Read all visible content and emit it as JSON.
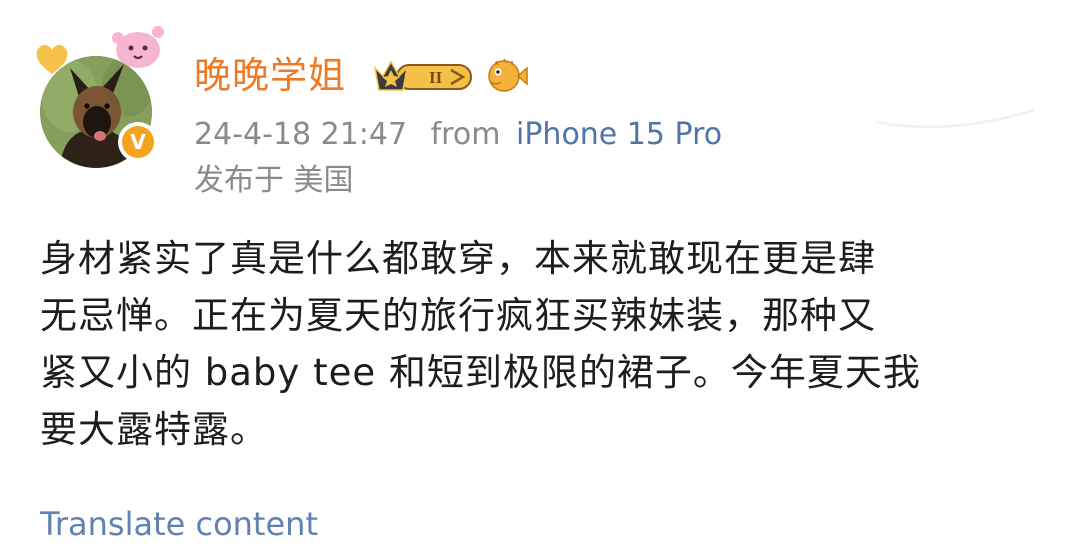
{
  "post": {
    "author": {
      "name": "晚晚学姐",
      "verified_mark": "V",
      "vip_level": "II",
      "avatar": "dog-avatar",
      "badges": [
        "crown-level-badge-icon",
        "pufferfish-badge-icon"
      ]
    },
    "meta": {
      "timestamp": "24-4-18 21:47",
      "from_label": "from",
      "device": "iPhone 15 Pro",
      "location": "发布于 美国"
    },
    "content_lines": [
      "身材紧实了真是什么都敢穿，本来就敢现在更是肆",
      "无忌惮。正在为夏天的旅行疯狂买辣妹装，那种又",
      "紧又小的 baby tee 和短到极限的裙子。今年夏天我",
      "要大露特露。"
    ],
    "translate_label": "Translate content"
  },
  "colors": {
    "username": "#ef7a24",
    "meta_text": "#8a8a8a",
    "source_link": "#5175a6",
    "translate_link": "#5f82b0",
    "body_text": "#1d1d1d",
    "verified_badge": "#f3a41c"
  }
}
